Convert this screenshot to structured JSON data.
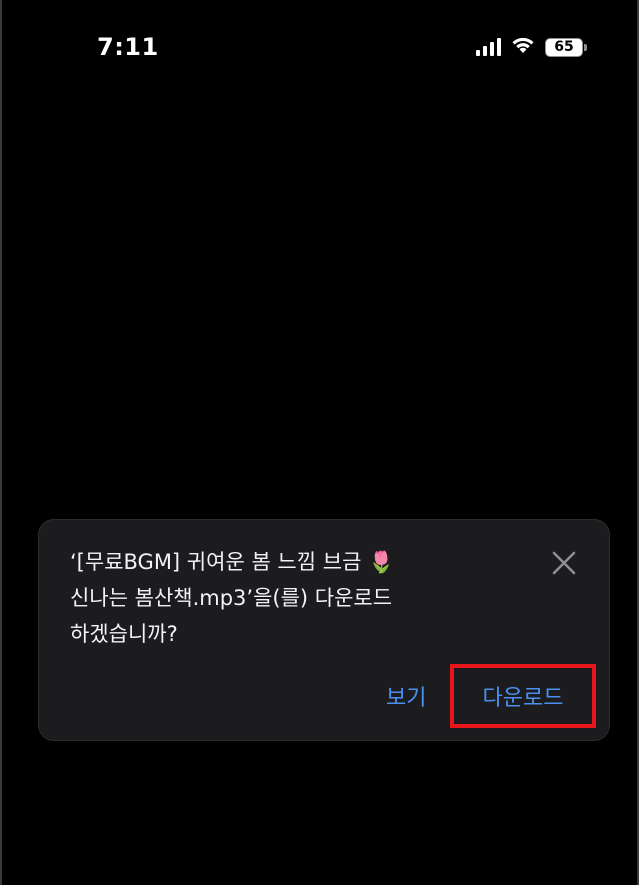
{
  "status_bar": {
    "time": "7:11",
    "battery_level": "65",
    "icons": [
      "signal-icon",
      "wifi-icon",
      "battery-icon"
    ]
  },
  "dialog": {
    "message": "‘[무료BGM] 귀여운 봄 느낌 브금 🌷\n신나는 봄산책.mp3’을(를) 다운로드\n하겠습니까?",
    "close_icon": "close-icon",
    "view_label": "보기",
    "download_label": "다운로드",
    "highlight_color": "#e8151b",
    "action_color": "#4a90f0"
  }
}
